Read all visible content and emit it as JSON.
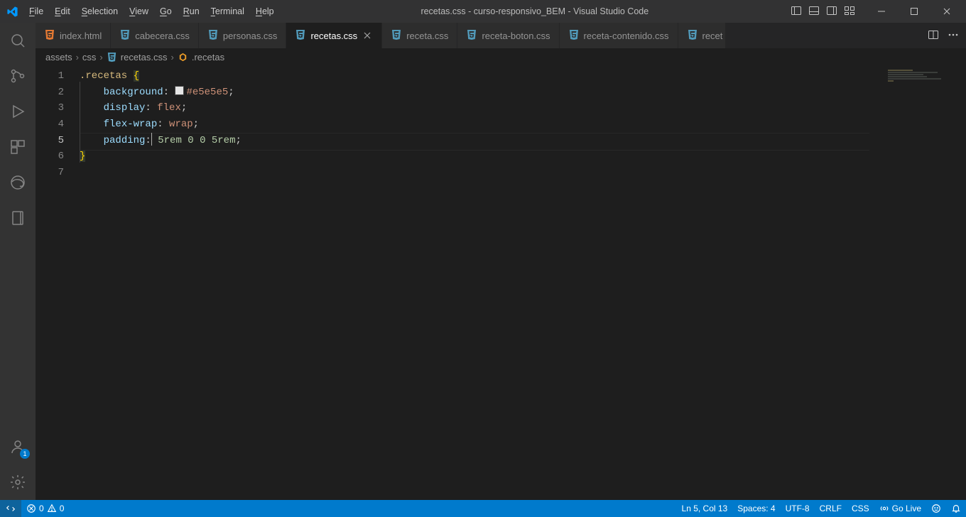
{
  "title": "recetas.css - curso-responsivo_BEM - Visual Studio Code",
  "menu": [
    "File",
    "Edit",
    "Selection",
    "View",
    "Go",
    "Run",
    "Terminal",
    "Help"
  ],
  "tabs": [
    {
      "icon": "html",
      "label": "index.html",
      "active": false
    },
    {
      "icon": "css",
      "label": "cabecera.css",
      "active": false
    },
    {
      "icon": "css",
      "label": "personas.css",
      "active": false
    },
    {
      "icon": "css",
      "label": "recetas.css",
      "active": true,
      "dirty": false,
      "closeShown": true
    },
    {
      "icon": "css",
      "label": "receta.css",
      "active": false
    },
    {
      "icon": "css",
      "label": "receta-boton.css",
      "active": false
    },
    {
      "icon": "css",
      "label": "receta-contenido.css",
      "active": false
    },
    {
      "icon": "css",
      "label": "recet",
      "active": false
    }
  ],
  "breadcrumbs": {
    "p1": "assets",
    "p2": "css",
    "p3": "recetas.css",
    "p4": ".recetas"
  },
  "code": {
    "l1_sel": ".recetas",
    "l1_brace": "{",
    "l2_prop": "background",
    "l2_hex": "#e5e5e5",
    "l3_prop": "display",
    "l3_val": "flex",
    "l4_prop": "flex-wrap",
    "l4_val": "wrap",
    "l5_prop": "padding",
    "l5_v1": "5rem",
    "l5_v2": "0",
    "l5_v3": "0",
    "l5_v4": "5rem",
    "l6_brace": "}"
  },
  "line_numbers": [
    "1",
    "2",
    "3",
    "4",
    "5",
    "6",
    "7"
  ],
  "status": {
    "errors": "0",
    "warnings": "0",
    "lncol": "Ln 5, Col 13",
    "spaces": "Spaces: 4",
    "encoding": "UTF-8",
    "eol": "CRLF",
    "lang": "CSS",
    "golive": "Go Live"
  },
  "account_badge": "1"
}
